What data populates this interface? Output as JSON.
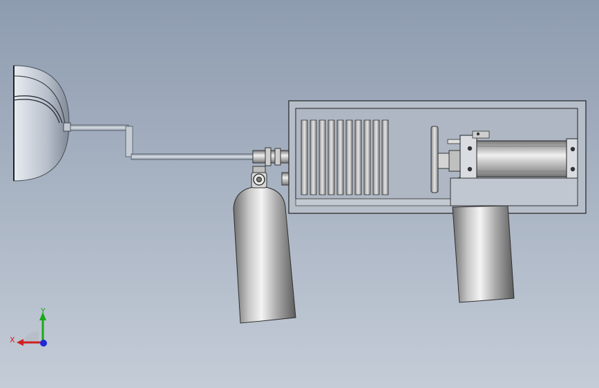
{
  "viewport": {
    "background_top": "#8e9cb0",
    "background_bottom": "#c4ccd7"
  },
  "triad": {
    "x_label": "X",
    "y_label": "Y",
    "x_color": "#d21f1f",
    "y_color": "#1aa81a",
    "z_color": "#1f2ad6"
  }
}
